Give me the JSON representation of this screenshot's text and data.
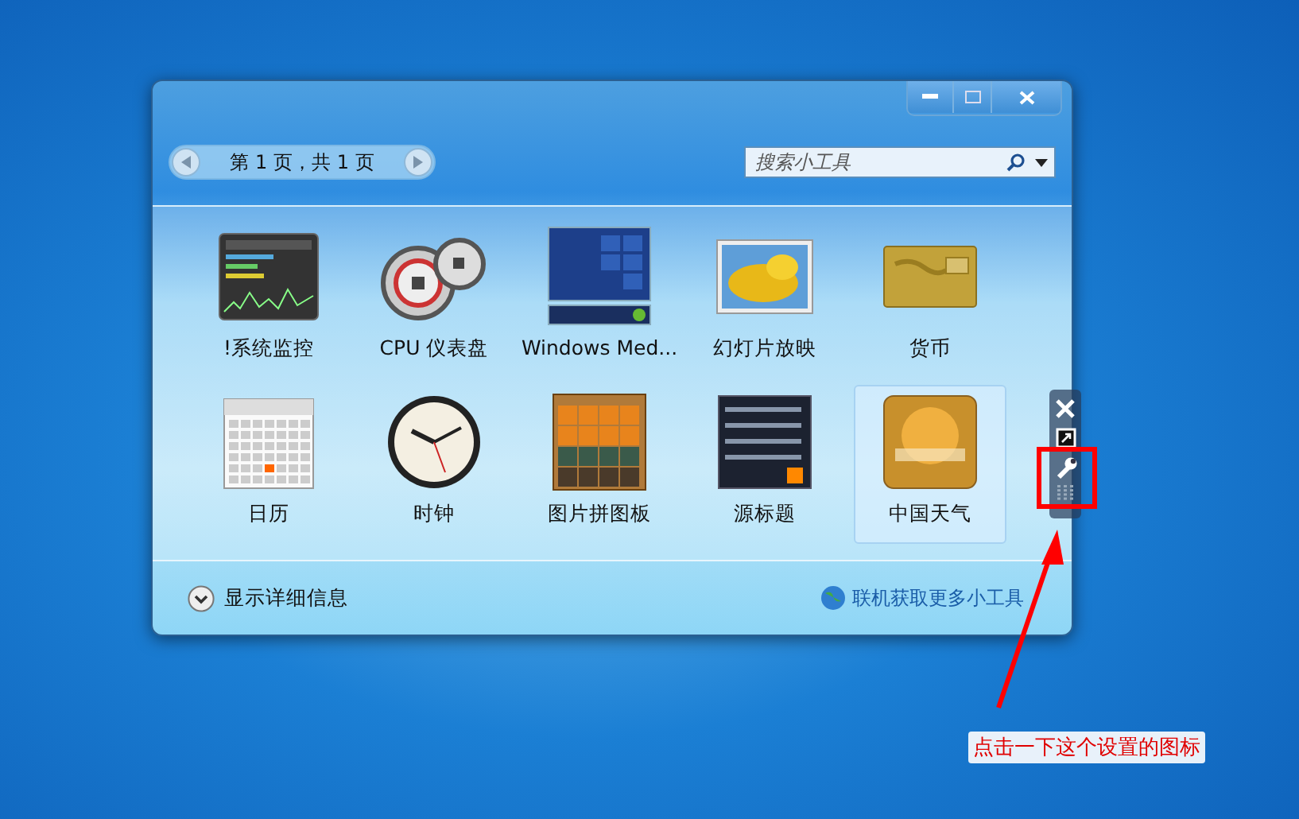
{
  "window": {
    "pager": {
      "text": "第 1 页，共 1 页"
    },
    "search": {
      "placeholder": "搜索小工具"
    }
  },
  "gadgets": [
    {
      "name": "!系统监控",
      "kind": "monitor",
      "selected": false
    },
    {
      "name": "CPU 仪表盘",
      "kind": "meter",
      "selected": false
    },
    {
      "name": "Windows Med...",
      "kind": "media",
      "selected": false
    },
    {
      "name": "幻灯片放映",
      "kind": "slideshow",
      "selected": false
    },
    {
      "name": "货币",
      "kind": "currency",
      "selected": false
    },
    {
      "name": "日历",
      "kind": "calendar",
      "selected": false
    },
    {
      "name": "时钟",
      "kind": "clock",
      "selected": false
    },
    {
      "name": "图片拼图板",
      "kind": "puzzle",
      "selected": false
    },
    {
      "name": "源标题",
      "kind": "feed",
      "selected": false
    },
    {
      "name": "中国天气",
      "kind": "weather",
      "selected": true
    }
  ],
  "footer": {
    "details": "显示详细信息",
    "online_link": "联机获取更多小工具"
  },
  "annotation": {
    "text": "点击一下这个设置的图标"
  }
}
